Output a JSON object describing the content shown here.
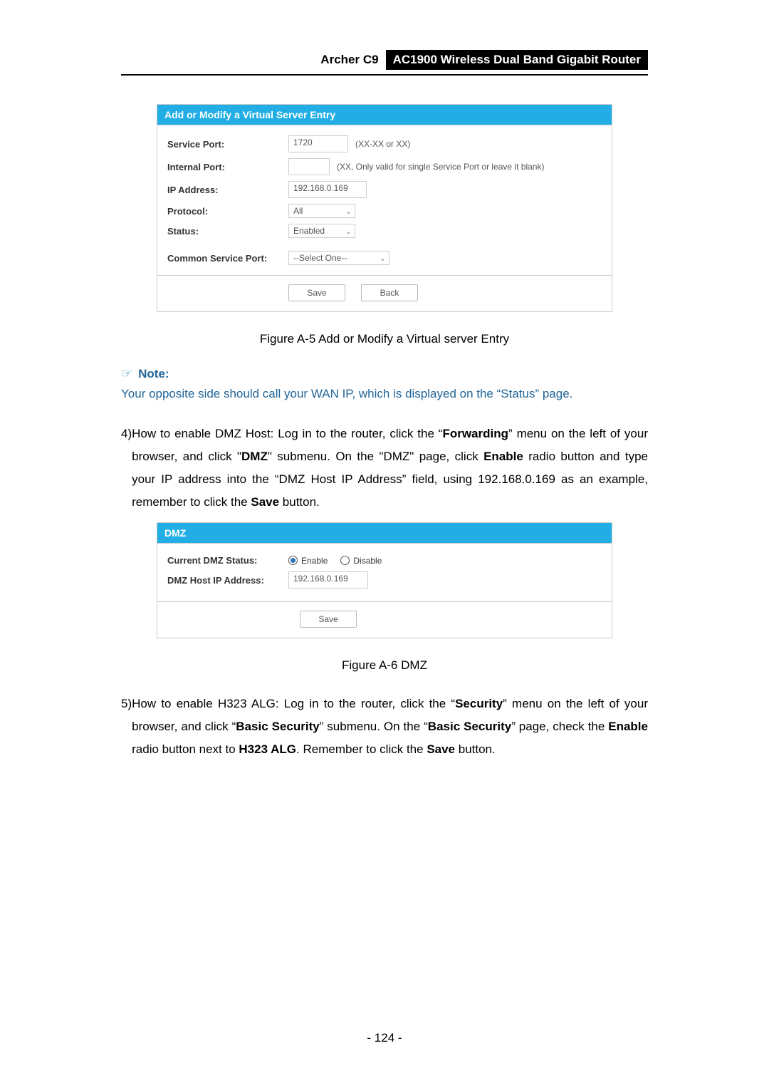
{
  "header": {
    "model": "Archer C9",
    "title": "AC1900 Wireless Dual Band Gigabit Router"
  },
  "panel1": {
    "title": "Add or Modify a Virtual Server Entry",
    "servicePort": {
      "label": "Service Port:",
      "value": "1720",
      "hint": "(XX-XX or XX)"
    },
    "internalPort": {
      "label": "Internal Port:",
      "value": "",
      "hint": "(XX, Only valid for single Service Port or leave it blank)"
    },
    "ipAddress": {
      "label": "IP Address:",
      "value": "192.168.0.169"
    },
    "protocol": {
      "label": "Protocol:",
      "value": "All"
    },
    "status": {
      "label": "Status:",
      "value": "Enabled"
    },
    "commonServicePort": {
      "label": "Common Service Port:",
      "value": "--Select One--"
    },
    "buttons": {
      "save": "Save",
      "back": "Back"
    }
  },
  "caption1": "Figure A-5 Add or Modify a Virtual server Entry",
  "note": {
    "label": "Note:",
    "text": "Your opposite side should call your WAN IP, which is displayed on the “Status” page."
  },
  "step4": {
    "num": "4)",
    "t1": "How to enable DMZ Host: Log in to the router, click the “",
    "b1": "Forwarding",
    "t2": "” menu on the left of your browser, and click \"",
    "b2": "DMZ",
    "t3": "\" submenu. On the \"DMZ\" page, click ",
    "b3": "Enable",
    "t4": " radio button and type your IP address into the “DMZ Host IP Address” field, using 192.168.0.169 as an example, remember to click the ",
    "b4": "Save",
    "t5": " button."
  },
  "panel2": {
    "title": "DMZ",
    "statusLabel": "Current DMZ Status:",
    "enable": "Enable",
    "disable": "Disable",
    "hostLabel": "DMZ Host IP Address:",
    "hostValue": "192.168.0.169",
    "save": "Save"
  },
  "caption2": "Figure A-6 DMZ",
  "step5": {
    "num": "5)",
    "t1": "How to enable H323 ALG: Log in to the router, click the “",
    "b1": "Security",
    "t2": "” menu on the left of your browser, and click “",
    "b2": "Basic Security",
    "t3": "” submenu. On the “",
    "b3": "Basic Security",
    "t4": "” page, check the ",
    "b4": "Enable",
    "t5": " radio button next to ",
    "b5": "H323 ALG",
    "t6": ". Remember to click the ",
    "b6": "Save",
    "t7": " button."
  },
  "pageNumber": "- 124 -"
}
